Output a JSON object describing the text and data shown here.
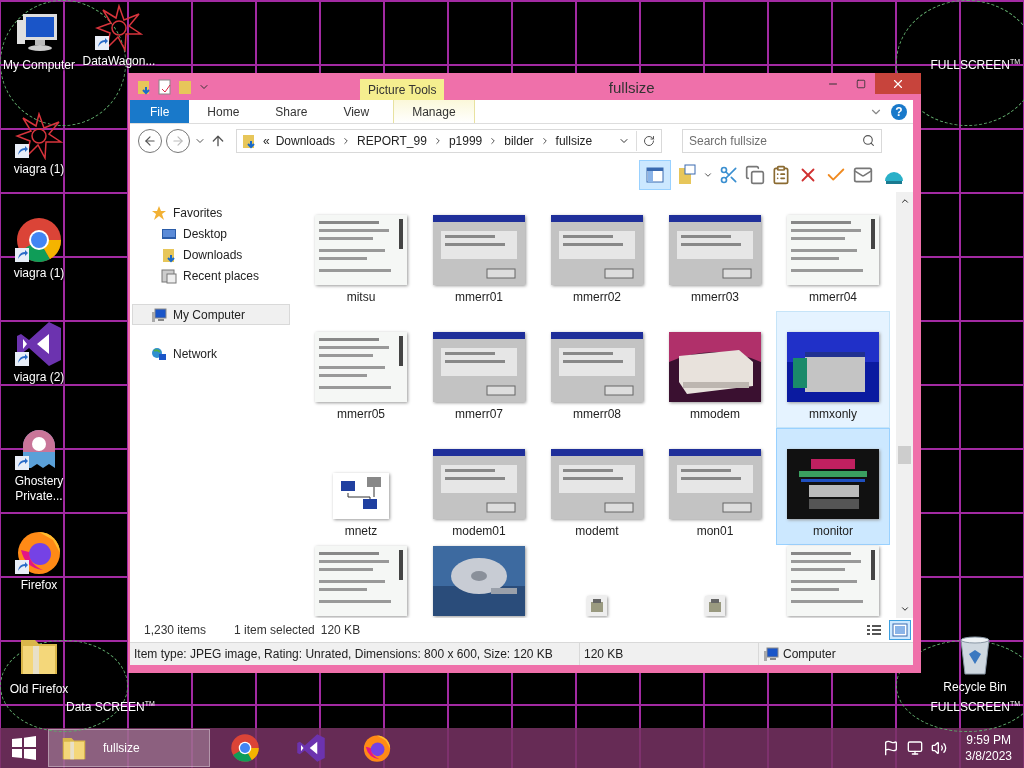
{
  "desktop": {
    "icons": [
      {
        "label": "My Computer",
        "kind": "computer",
        "shortcut": false
      },
      {
        "label": "viagra (1)",
        "kind": "star",
        "shortcut": true
      },
      {
        "label": "viagra (1)",
        "kind": "chrome",
        "shortcut": true
      },
      {
        "label": "viagra (2)",
        "kind": "vs",
        "shortcut": true
      },
      {
        "label": "Ghostery Private...",
        "kind": "ghost",
        "shortcut": true
      },
      {
        "label": "Firefox",
        "kind": "firefox",
        "shortcut": true
      },
      {
        "label": "Old Firefox",
        "kind": "folder",
        "shortcut": false
      }
    ],
    "second_column_icon": {
      "label": "DataWagon...",
      "kind": "star",
      "shortcut": true
    },
    "recycle_bin": {
      "label": "Recycle Bin"
    },
    "wallpaper_texts": [
      "FULLSCREEN$^{TM}$",
      "Data SCREEN$^{TM}$",
      "FULLSCREEN$^{TM}$"
    ]
  },
  "window": {
    "title": "fullsize",
    "context_tab_group": "Picture Tools",
    "help_label": "?",
    "ribbon_tabs": [
      {
        "label": "File",
        "kind": "file",
        "selected": false
      },
      {
        "label": "Home",
        "kind": "normal",
        "selected": false
      },
      {
        "label": "Share",
        "kind": "normal",
        "selected": false
      },
      {
        "label": "View",
        "kind": "normal",
        "selected": false
      },
      {
        "label": "Manage",
        "kind": "context",
        "selected": false
      }
    ],
    "address": {
      "prefix": "«",
      "crumbs": [
        "Downloads",
        "REPORT_99",
        "p1999",
        "bilder",
        "fullsize"
      ]
    },
    "search": {
      "placeholder": "Search fullsize"
    },
    "toolbar": {
      "preview_pane_on": true
    },
    "nav_pane": [
      {
        "label": "Favorites",
        "kind": "star",
        "selected": false,
        "children": [
          {
            "label": "Desktop",
            "kind": "desktop",
            "selected": false
          },
          {
            "label": "Downloads",
            "kind": "downloads",
            "selected": false
          },
          {
            "label": "Recent places",
            "kind": "recent",
            "selected": false
          }
        ]
      },
      {
        "label": "My Computer",
        "kind": "computer",
        "selected": true
      },
      {
        "label": "Network",
        "kind": "network",
        "selected": false
      }
    ],
    "files": [
      {
        "name": "mitsu",
        "selected": false,
        "hover": false
      },
      {
        "name": "mmerr01",
        "selected": false,
        "hover": false
      },
      {
        "name": "mmerr02",
        "selected": false,
        "hover": false
      },
      {
        "name": "mmerr03",
        "selected": false,
        "hover": false
      },
      {
        "name": "mmerr04",
        "selected": false,
        "hover": false
      },
      {
        "name": "mmerr05",
        "selected": false,
        "hover": false
      },
      {
        "name": "mmerr07",
        "selected": false,
        "hover": false
      },
      {
        "name": "mmerr08",
        "selected": false,
        "hover": false
      },
      {
        "name": "mmodem",
        "selected": false,
        "hover": false
      },
      {
        "name": "mmxonly",
        "selected": false,
        "hover": true
      },
      {
        "name": "mnetz",
        "selected": false,
        "hover": false
      },
      {
        "name": "modem01",
        "selected": false,
        "hover": false
      },
      {
        "name": "modemt",
        "selected": false,
        "hover": false
      },
      {
        "name": "mon01",
        "selected": false,
        "hover": false
      },
      {
        "name": "monitor",
        "selected": true,
        "hover": false
      },
      {
        "selected": false,
        "hover": false
      },
      {
        "selected": false,
        "hover": false
      },
      {
        "selected": false,
        "hover": false
      },
      {
        "selected": false,
        "hover": false
      },
      {
        "selected": false,
        "hover": false
      }
    ],
    "status": {
      "count": "1,230 items",
      "selection": "1 item selected",
      "size": "120 KB"
    },
    "view_buttons": [
      {
        "kind": "details",
        "selected": false
      },
      {
        "kind": "large",
        "selected": true
      }
    ],
    "details_bar": {
      "info": "Item type: JPEG image, Rating: Unrated, Dimensions: 800 x 600, Size: 120 KB",
      "size": "120 KB",
      "location": "Computer"
    }
  },
  "taskbar": {
    "tasks": [
      {
        "label": "fullsize",
        "kind": "folder",
        "active": true
      },
      {
        "kind": "chrome",
        "active": false
      },
      {
        "kind": "vs",
        "active": false
      },
      {
        "kind": "firefox",
        "active": false
      }
    ],
    "time": "9:59 PM",
    "date": "3/8/2023"
  }
}
